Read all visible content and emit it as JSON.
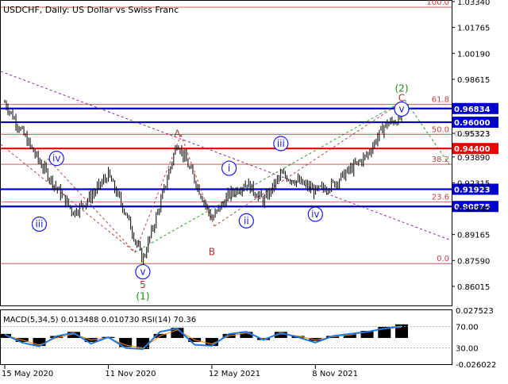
{
  "header": {
    "symbol_line": "USDCHF, Daily:  US Dollar vs Swiss Franc"
  },
  "colors": {
    "background": "#ffffff",
    "axis": "#000000",
    "candle": "#000000",
    "support_blue": "#0000cc",
    "resistance_red": "#ee0000",
    "fib_line": "#c04040",
    "wave_blue": "#1a1aee",
    "wave_green": "#1a8a1a",
    "wave_brown": "#b03030",
    "trend_purple": "#7a1a7a",
    "grid_dotted": "#a0a0a0",
    "macd_line": "#1e90ff",
    "rsi_line": "#2277dd"
  },
  "chart_data": [
    {
      "type": "candlestick",
      "title": "USDCHF, Daily:  US Dollar vs Swiss Franc",
      "timeframe": "Daily",
      "x_tick_labels": [
        "15 May 2020",
        "11 Nov 2020",
        "12 May 2021",
        "8 Nov 2021"
      ],
      "y_tick_labels": [
        "1.03340",
        "1.01765",
        "1.00190",
        "0.98615",
        "0.95323",
        "0.93890",
        "0.92315",
        "0.90740",
        "0.89165",
        "0.87590",
        "0.86015"
      ],
      "ylim": [
        0.849,
        1.0334
      ],
      "price_series": {
        "points": [
          [
            "15 May 2020",
            0.972
          ],
          [
            "Jun 2020",
            0.954
          ],
          [
            "Jul 2020",
            0.936
          ],
          [
            "Aug 2020",
            0.92
          ],
          [
            "Sep 2020",
            0.905
          ],
          [
            "Oct 2020",
            0.915
          ],
          [
            "11 Nov 2020",
            0.928
          ],
          [
            "Dec 2020",
            0.905
          ],
          [
            "Jan 2021",
            0.876
          ],
          [
            "Feb 2021",
            0.91
          ],
          [
            "Mar 2021",
            0.948
          ],
          [
            "Apr 2021",
            0.925
          ],
          [
            "12 May 2021",
            0.901
          ],
          [
            "Jun 2021",
            0.916
          ],
          [
            "Jul 2021",
            0.923
          ],
          [
            "Aug 2021",
            0.912
          ],
          [
            "Sep 2021",
            0.928
          ],
          [
            "Oct 2021",
            0.924
          ],
          [
            "8 Nov 2021",
            0.918
          ],
          [
            "Dec 2021",
            0.922
          ],
          [
            "Jan 2022",
            0.931
          ],
          [
            "Feb 2022",
            0.94
          ],
          [
            "Mar 2022",
            0.958
          ],
          [
            "Apr 2022",
            0.963
          ]
        ]
      },
      "price_levels": [
        {
          "label": "0.96834",
          "value": 0.96834,
          "style": "blue"
        },
        {
          "label": "0.96000",
          "value": 0.96,
          "style": "blue"
        },
        {
          "label": "0.95323",
          "value": 0.95323,
          "style": "plain"
        },
        {
          "label": "0.94400",
          "value": 0.944,
          "style": "red"
        },
        {
          "label": "0.91923",
          "value": 0.91923,
          "style": "blue"
        },
        {
          "label": "0.90875",
          "value": 0.90875,
          "style": "blue"
        }
      ],
      "fibonacci_levels": [
        {
          "label": "100.0",
          "value": 1.03
        },
        {
          "label": "61.8",
          "value": 0.9708
        },
        {
          "label": "50.0",
          "value": 0.9526
        },
        {
          "label": "38.2",
          "value": 0.9344
        },
        {
          "label": "23.6",
          "value": 0.9115
        },
        {
          "label": "0.0",
          "value": 0.874
        }
      ],
      "wave_labels": [
        {
          "text": "iii",
          "date": "Jul 2020",
          "price": 0.898,
          "style": "blue-circle"
        },
        {
          "text": "iv",
          "date": "Aug 2020",
          "price": 0.938,
          "style": "blue-circle"
        },
        {
          "text": "v",
          "date": "Jan 2021",
          "price": 0.869,
          "style": "blue-circle"
        },
        {
          "text": "5",
          "date": "Jan 2021",
          "price": 0.861,
          "style": "brown"
        },
        {
          "text": "(1)",
          "date": "Jan 2021",
          "price": 0.854,
          "style": "green"
        },
        {
          "text": "A",
          "date": "Mar 2021",
          "price": 0.953,
          "style": "brown"
        },
        {
          "text": "B",
          "date": "12 May 2021",
          "price": 0.881,
          "style": "brown"
        },
        {
          "text": "i",
          "date": "Jun 2021",
          "price": 0.932,
          "style": "blue-circle"
        },
        {
          "text": "ii",
          "date": "Jul 2021",
          "price": 0.9,
          "style": "blue-circle"
        },
        {
          "text": "iii",
          "date": "Sep 2021",
          "price": 0.947,
          "style": "blue-circle"
        },
        {
          "text": "iv",
          "date": "8 Nov 2021",
          "price": 0.904,
          "style": "blue-circle"
        },
        {
          "text": "v",
          "date": "Apr 2022",
          "price": 0.968,
          "style": "blue-circle"
        },
        {
          "text": "C",
          "date": "Apr 2022",
          "price": 0.9748,
          "style": "brown"
        },
        {
          "text": "(2)",
          "date": "Apr 2022",
          "price": 0.9805,
          "style": "green"
        }
      ]
    },
    {
      "type": "line",
      "title": "MACD(5,34,5) 0.013488 0.010730 RSI(14) 70.36",
      "x_tick_labels": [
        "15 May 2020",
        "11 Nov 2020",
        "12 May 2021",
        "8 Nov 2021"
      ],
      "y_tick_labels": [
        "0.027523",
        "70.00",
        "30.00",
        "-0.026022"
      ],
      "series": [
        {
          "name": "MACD",
          "values": [
            0.004,
            -0.004,
            -0.008,
            0.002,
            0.006,
            -0.004,
            0.001,
            -0.009,
            -0.011,
            0.004,
            0.01,
            -0.004,
            -0.008,
            0.004,
            0.006,
            -0.002,
            0.006,
            0.002,
            -0.003,
            0.002,
            0.004,
            0.007,
            0.011,
            0.013488
          ]
        },
        {
          "name": "Signal",
          "values": [
            0.003,
            -0.002,
            -0.007,
            0.0,
            0.004,
            -0.002,
            0.0,
            -0.007,
            -0.01,
            0.002,
            0.008,
            -0.002,
            -0.006,
            0.002,
            0.005,
            -0.001,
            0.004,
            0.002,
            -0.002,
            0.001,
            0.003,
            0.006,
            0.009,
            0.01073
          ]
        },
        {
          "name": "RSI",
          "values": [
            55,
            40,
            33,
            52,
            58,
            38,
            50,
            30,
            28,
            60,
            66,
            36,
            34,
            56,
            60,
            45,
            58,
            50,
            40,
            52,
            56,
            60,
            66,
            70.36
          ]
        }
      ]
    }
  ]
}
